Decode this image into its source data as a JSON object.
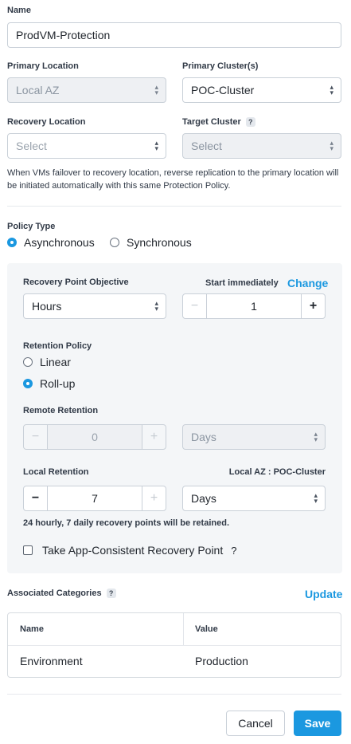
{
  "name": {
    "label": "Name",
    "value": "ProdVM-Protection"
  },
  "primary_location": {
    "label": "Primary Location",
    "value": "Local AZ"
  },
  "primary_cluster": {
    "label": "Primary Cluster(s)",
    "value": "POC-Cluster"
  },
  "recovery_location": {
    "label": "Recovery Location",
    "value": "Select"
  },
  "target_cluster": {
    "label": "Target Cluster",
    "help": "?",
    "value": "Select"
  },
  "failover_note": "When VMs failover to recovery location, reverse replication to the primary location will be initiated automatically with this same Protection Policy.",
  "policy_type": {
    "label": "Policy Type",
    "options": [
      "Asynchronous",
      "Synchronous"
    ],
    "selected": "Asynchronous"
  },
  "rpo": {
    "label": "Recovery Point Objective",
    "unit": "Hours",
    "start_label": "Start immediately",
    "change_link": "Change",
    "value": "1",
    "minus": "−",
    "plus": "+"
  },
  "retention_policy": {
    "label": "Retention Policy",
    "options": [
      "Linear",
      "Roll-up"
    ],
    "selected": "Roll-up"
  },
  "remote_retention": {
    "label": "Remote Retention",
    "value": "0",
    "unit": "Days",
    "minus": "−",
    "plus": "+"
  },
  "local_retention": {
    "label": "Local Retention",
    "location": "Local AZ : POC-Cluster",
    "value": "7",
    "unit": "Days",
    "minus": "−",
    "plus": "+",
    "summary": "24 hourly, 7 daily recovery points will be retained."
  },
  "app_consistent": {
    "label": "Take App-Consistent Recovery Point",
    "help": "?",
    "checked": false
  },
  "categories": {
    "label": "Associated Categories",
    "help": "?",
    "update_link": "Update",
    "columns": [
      "Name",
      "Value"
    ],
    "rows": [
      {
        "name": "Environment",
        "value": "Production"
      }
    ]
  },
  "actions": {
    "cancel": "Cancel",
    "save": "Save"
  },
  "colors": {
    "accent": "#1b98e0",
    "panel": "#f4f6f8"
  }
}
